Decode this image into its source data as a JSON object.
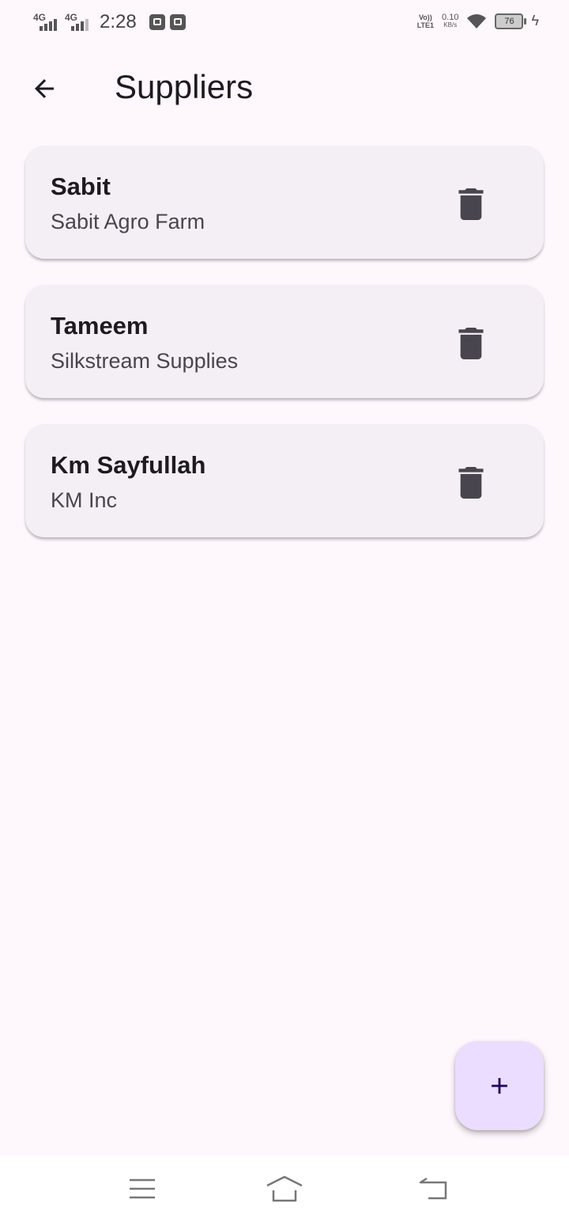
{
  "status_bar": {
    "time": "2:28",
    "sim1": "4G",
    "sim2": "4G",
    "volte_top": "Vo))",
    "volte_bottom": "LTE1",
    "net_speed": "0.10",
    "net_speed_unit": "KB/s",
    "battery": "76"
  },
  "app_bar": {
    "title": "Suppliers",
    "back_icon": "arrow-back-icon"
  },
  "suppliers": [
    {
      "name": "Sabit",
      "company": "Sabit Agro Farm"
    },
    {
      "name": "Tameem",
      "company": "Silkstream Supplies"
    },
    {
      "name": "Km Sayfullah",
      "company": "KM Inc"
    }
  ],
  "fab": {
    "icon": "plus-icon",
    "color": "#eaddff",
    "icon_color": "#21005d"
  },
  "nav_bar": {
    "items": [
      "menu-icon",
      "home-icon",
      "back-icon"
    ]
  },
  "colors": {
    "background": "#fef7fc",
    "card": "#f3eff4",
    "delete_icon": "#49454f"
  }
}
